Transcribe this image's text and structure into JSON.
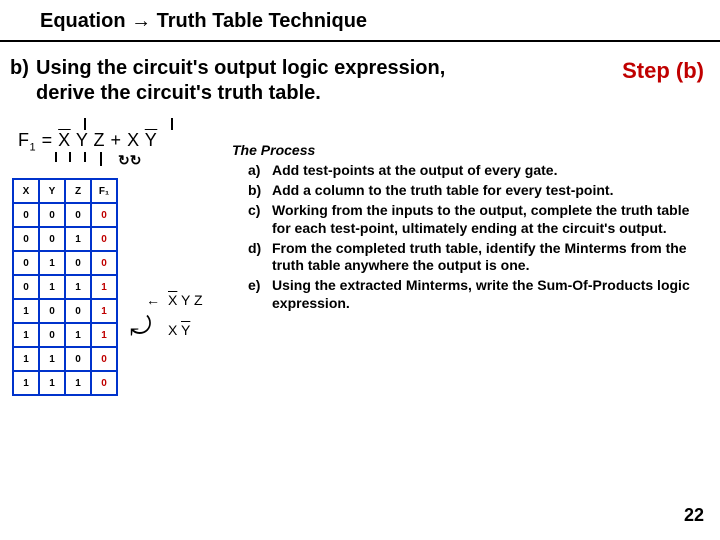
{
  "title": "Equation → Truth Table Technique",
  "step_label": "Step (b)",
  "subheading_key": "b)",
  "subheading_text_line1": "Using the circuit's output logic expression,",
  "subheading_text_line2": "derive the circuit's truth table.",
  "equation": {
    "lhs": "F",
    "lhs_sub": "1",
    "eq": " = ",
    "t1a": "X",
    "t1b": "Y",
    "t1c": "Z",
    "plus": " + ",
    "t2a": "X",
    "t2b": "Y"
  },
  "midterms": {
    "arrow": "←",
    "row1": "X Y Z",
    "row2": "X Y"
  },
  "truth_table": {
    "headers": [
      "X",
      "Y",
      "Z",
      "F₁"
    ],
    "rows": [
      [
        "0",
        "0",
        "0",
        "0"
      ],
      [
        "0",
        "0",
        "1",
        "0"
      ],
      [
        "0",
        "1",
        "0",
        "0"
      ],
      [
        "0",
        "1",
        "1",
        "1"
      ],
      [
        "1",
        "0",
        "0",
        "1"
      ],
      [
        "1",
        "0",
        "1",
        "1"
      ],
      [
        "1",
        "1",
        "0",
        "0"
      ],
      [
        "1",
        "1",
        "1",
        "0"
      ]
    ]
  },
  "process": {
    "heading": "The Process",
    "items": [
      {
        "key": "a)",
        "text": "Add test-points at the output of every gate."
      },
      {
        "key": "b)",
        "text": "Add a column to the truth table for every test-point."
      },
      {
        "key": "c)",
        "text": "Working from the inputs to the output, complete the truth table for each test-point, ultimately ending at the circuit's output."
      },
      {
        "key": "d)",
        "text": "From the completed truth table, identify the Minterms from the truth table anywhere the output is one."
      },
      {
        "key": "e)",
        "text": "Using the extracted Minterms, write the Sum-Of-Products logic expression."
      }
    ]
  },
  "page_number": "22",
  "loop_glyph": "↻↻"
}
